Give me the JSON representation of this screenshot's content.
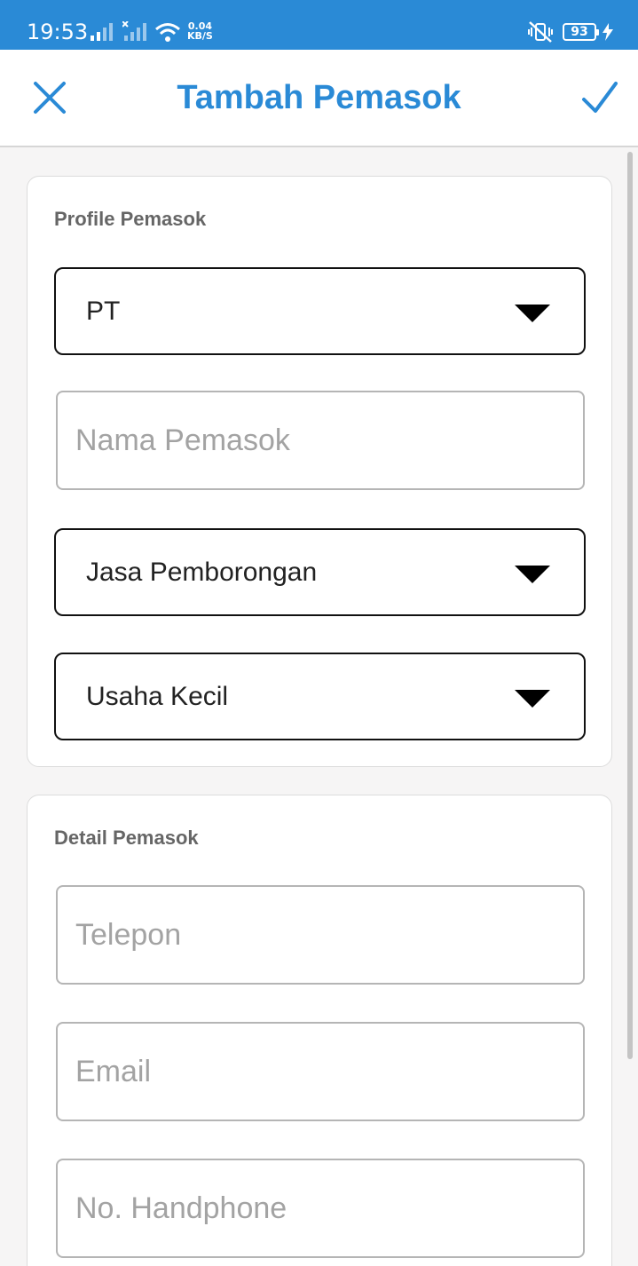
{
  "status_bar": {
    "time": "19:53",
    "net_speed_value": "0.04",
    "net_speed_unit": "KB/S",
    "battery": "93"
  },
  "app_bar": {
    "title": "Tambah Pemasok",
    "close_icon": "close-icon",
    "confirm_icon": "check-icon",
    "accent_color": "#2a8ad6"
  },
  "profile_section": {
    "title": "Profile Pemasok",
    "company_type": {
      "selected": "PT"
    },
    "name_field": {
      "value": "",
      "placeholder": "Nama Pemasok"
    },
    "business_field": {
      "selected": "Jasa Pemborongan"
    },
    "business_scale": {
      "selected": "Usaha Kecil"
    }
  },
  "detail_section": {
    "title": "Detail Pemasok",
    "phone_field": {
      "value": "",
      "placeholder": "Telepon"
    },
    "email_field": {
      "value": "",
      "placeholder": "Email"
    },
    "mobile_field": {
      "value": "",
      "placeholder": "No. Handphone"
    }
  }
}
